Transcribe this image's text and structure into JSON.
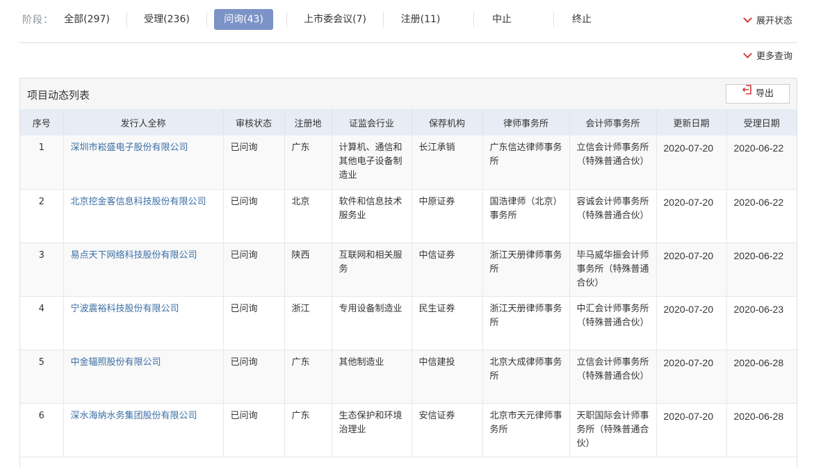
{
  "stage_filter": {
    "label": "阶段：",
    "tabs": [
      {
        "label": "全部(297)",
        "active": false
      },
      {
        "label": "受理(236)",
        "active": false
      },
      {
        "label": "问询(43)",
        "active": true
      },
      {
        "label": "上市委会议(7)",
        "active": false
      },
      {
        "label": "注册(11)",
        "active": false
      },
      {
        "label": "中止",
        "active": false
      },
      {
        "label": "终止",
        "active": false
      }
    ],
    "expand_label": "展开状态",
    "more_query_label": "更多查询"
  },
  "panel": {
    "title": "项目动态列表",
    "export_label": "导出"
  },
  "table": {
    "columns": [
      "序号",
      "发行人全称",
      "审核状态",
      "注册地",
      "证监会行业",
      "保荐机构",
      "律师事务所",
      "会计师事务所",
      "更新日期",
      "受理日期"
    ],
    "rows": [
      {
        "idx": "1",
        "name": "深圳市崧盛电子股份有限公司",
        "status": "已问询",
        "region": "广东",
        "industry": "计算机、通信和其他电子设备制造业",
        "sponsor": "长江承销",
        "law_firm": "广东信达律师事务所",
        "accountant": "立信会计师事务所（特殊普通合伙）",
        "updated": "2020-07-20",
        "accepted": "2020-06-22"
      },
      {
        "idx": "2",
        "name": "北京挖金客信息科技股份有限公司",
        "status": "已问询",
        "region": "北京",
        "industry": "软件和信息技术服务业",
        "sponsor": "中原证券",
        "law_firm": "国浩律师（北京）事务所",
        "accountant": "容诚会计师事务所（特殊普通合伙）",
        "updated": "2020-07-20",
        "accepted": "2020-06-22"
      },
      {
        "idx": "3",
        "name": "易点天下网络科技股份有限公司",
        "status": "已问询",
        "region": "陕西",
        "industry": "互联网和相关服务",
        "sponsor": "中信证券",
        "law_firm": "浙江天册律师事务所",
        "accountant": "毕马威华振会计师事务所（特殊普通合伙）",
        "updated": "2020-07-20",
        "accepted": "2020-06-22"
      },
      {
        "idx": "4",
        "name": "宁波震裕科技股份有限公司",
        "status": "已问询",
        "region": "浙江",
        "industry": "专用设备制造业",
        "sponsor": "民生证券",
        "law_firm": "浙江天册律师事务所",
        "accountant": "中汇会计师事务所（特殊普通合伙）",
        "updated": "2020-07-20",
        "accepted": "2020-06-23"
      },
      {
        "idx": "5",
        "name": "中金辐照股份有限公司",
        "status": "已问询",
        "region": "广东",
        "industry": "其他制造业",
        "sponsor": "中信建投",
        "law_firm": "北京大成律师事务所",
        "accountant": "立信会计师事务所（特殊普通合伙）",
        "updated": "2020-07-20",
        "accepted": "2020-06-28"
      },
      {
        "idx": "6",
        "name": "深水海纳水务集团股份有限公司",
        "status": "已问询",
        "region": "广东",
        "industry": "生态保护和环境治理业",
        "sponsor": "安信证券",
        "law_firm": "北京市天元律师事务所",
        "accountant": "天职国际会计师事务所（特殊普通合伙）",
        "updated": "2020-07-20",
        "accepted": "2020-06-28"
      }
    ]
  }
}
